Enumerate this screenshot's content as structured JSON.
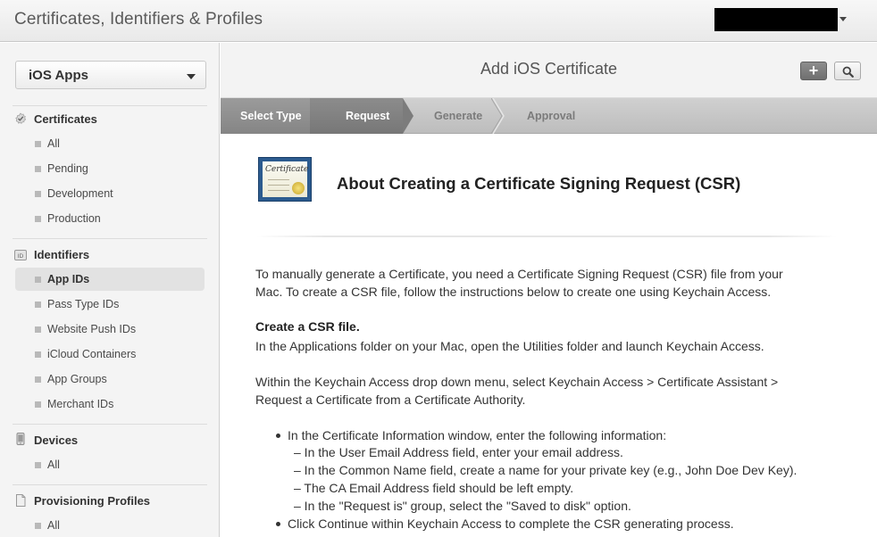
{
  "header": {
    "app_title": "Certificates, Identifiers & Profiles"
  },
  "sidebar": {
    "platform": "iOS Apps",
    "sections": [
      {
        "title": "Certificates",
        "icon": "certificate-icon",
        "items": [
          "All",
          "Pending",
          "Development",
          "Production"
        ]
      },
      {
        "title": "Identifiers",
        "icon": "id-badge-icon",
        "items": [
          "App IDs",
          "Pass Type IDs",
          "Website Push IDs",
          "iCloud Containers",
          "App Groups",
          "Merchant IDs"
        ]
      },
      {
        "title": "Devices",
        "icon": "device-icon",
        "items": [
          "All"
        ]
      },
      {
        "title": "Provisioning Profiles",
        "icon": "document-icon",
        "items": [
          "All"
        ]
      }
    ],
    "active_item": "App IDs"
  },
  "main": {
    "title": "Add iOS Certificate",
    "add_button": "+",
    "steps": [
      "Select Type",
      "Request",
      "Generate",
      "Approval"
    ],
    "current_step": "Request",
    "icon_word": "Certificate",
    "heading": "About Creating a Certificate Signing Request (CSR)",
    "intro_1": "To manually generate a Certificate, you need a Certificate Signing Request (CSR) file from your",
    "intro_2": "Mac. To create a CSR file, follow the instructions below to create one using Keychain Access.",
    "create_heading": "Create a CSR file.",
    "create_text": "In the Applications folder on your Mac, open the Utilities folder and launch Keychain Access.",
    "within_1": "Within the Keychain Access drop down menu, select Keychain Access > Certificate Assistant >",
    "within_2": "Request a Certificate from a Certificate Authority.",
    "bullet_1": "In the Certificate Information window, enter the following information:",
    "sub_1": "– In the User Email Address field, enter your email address.",
    "sub_2": "– In the Common Name field, create a name for your private key (e.g., John Doe Dev Key).",
    "sub_3": "– The CA Email Address field should be left empty.",
    "sub_4": "– In the \"Request is\" group, select the \"Saved to disk\" option.",
    "bullet_2": "Click Continue within Keychain Access to complete the CSR generating process."
  }
}
